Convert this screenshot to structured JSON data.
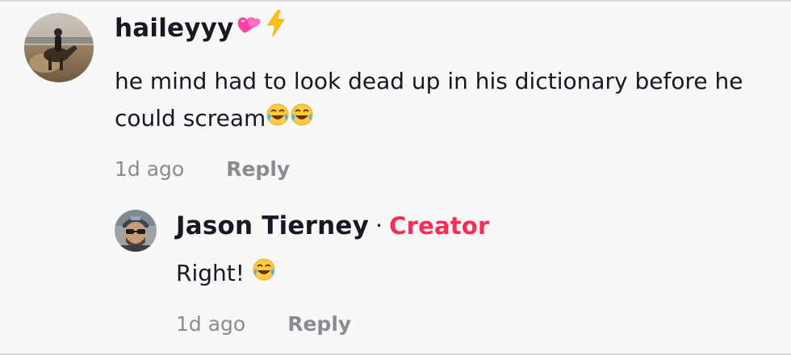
{
  "comment": {
    "username": "haileyyy",
    "username_emojis": [
      "heart-icon",
      "lightning-icon"
    ],
    "text": "he mind had to look dead up in his dictionary before he could scream",
    "text_emojis": [
      "laughing-crying-emoji",
      "laughing-crying-emoji"
    ],
    "time": "1d ago",
    "reply_label": "Reply"
  },
  "reply": {
    "username": "Jason Tierney",
    "separator": "·",
    "badge": "Creator",
    "text": "Right!",
    "text_emojis": [
      "laughing-crying-emoji"
    ],
    "time": "1d ago",
    "reply_label": "Reply"
  },
  "colors": {
    "background": "#f8f8f8",
    "text": "#161823",
    "muted": "#8a8b91",
    "creator": "#fe2c55"
  }
}
